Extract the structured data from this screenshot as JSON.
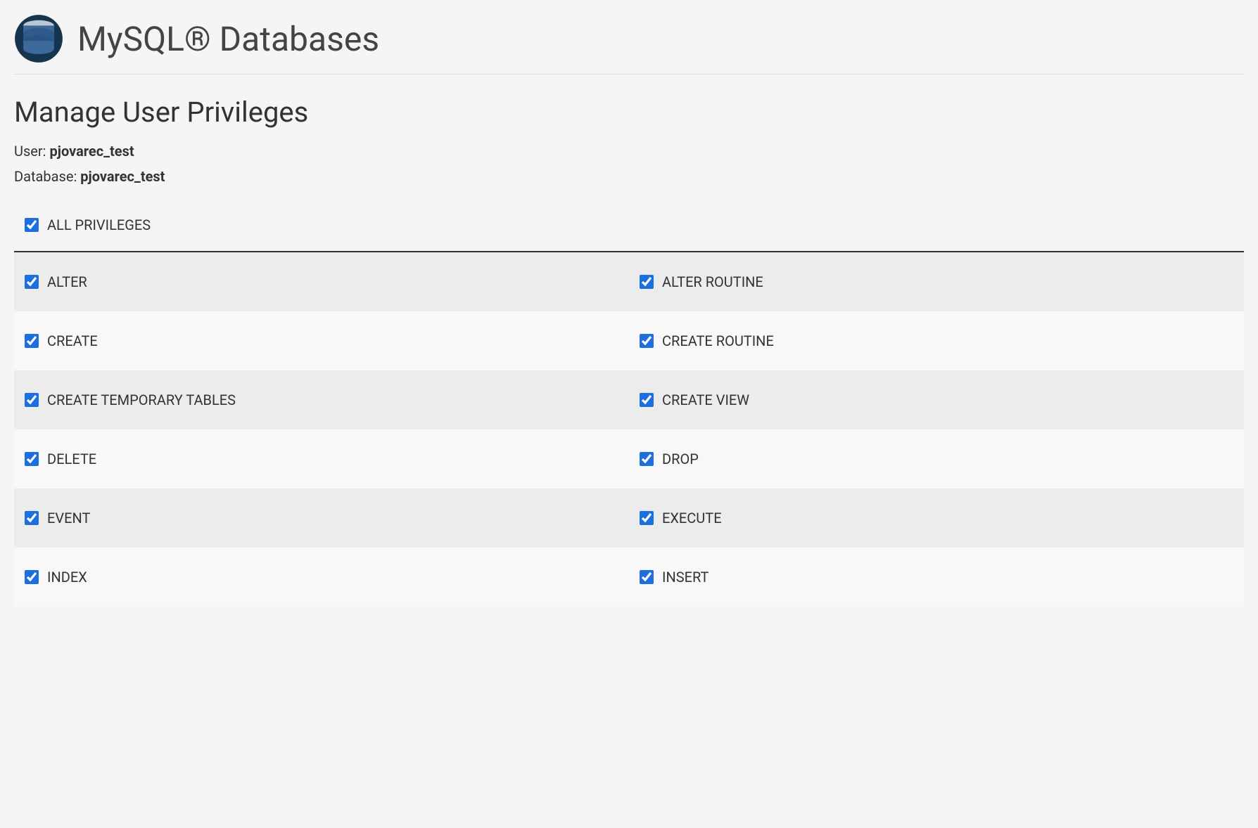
{
  "header": {
    "title": "MySQL® Databases"
  },
  "section": {
    "title": "Manage User Privileges",
    "user_label": "User: ",
    "user_value": "pjovarec_test",
    "database_label": "Database: ",
    "database_value": "pjovarec_test"
  },
  "all_privileges": {
    "label": "ALL PRIVILEGES",
    "checked": true
  },
  "privileges": [
    {
      "left": {
        "label": "ALTER",
        "checked": true
      },
      "right": {
        "label": "ALTER ROUTINE",
        "checked": true
      }
    },
    {
      "left": {
        "label": "CREATE",
        "checked": true
      },
      "right": {
        "label": "CREATE ROUTINE",
        "checked": true
      }
    },
    {
      "left": {
        "label": "CREATE TEMPORARY TABLES",
        "checked": true
      },
      "right": {
        "label": "CREATE VIEW",
        "checked": true
      }
    },
    {
      "left": {
        "label": "DELETE",
        "checked": true
      },
      "right": {
        "label": "DROP",
        "checked": true
      }
    },
    {
      "left": {
        "label": "EVENT",
        "checked": true
      },
      "right": {
        "label": "EXECUTE",
        "checked": true
      }
    },
    {
      "left": {
        "label": "INDEX",
        "checked": true
      },
      "right": {
        "label": "INSERT",
        "checked": true
      }
    }
  ]
}
